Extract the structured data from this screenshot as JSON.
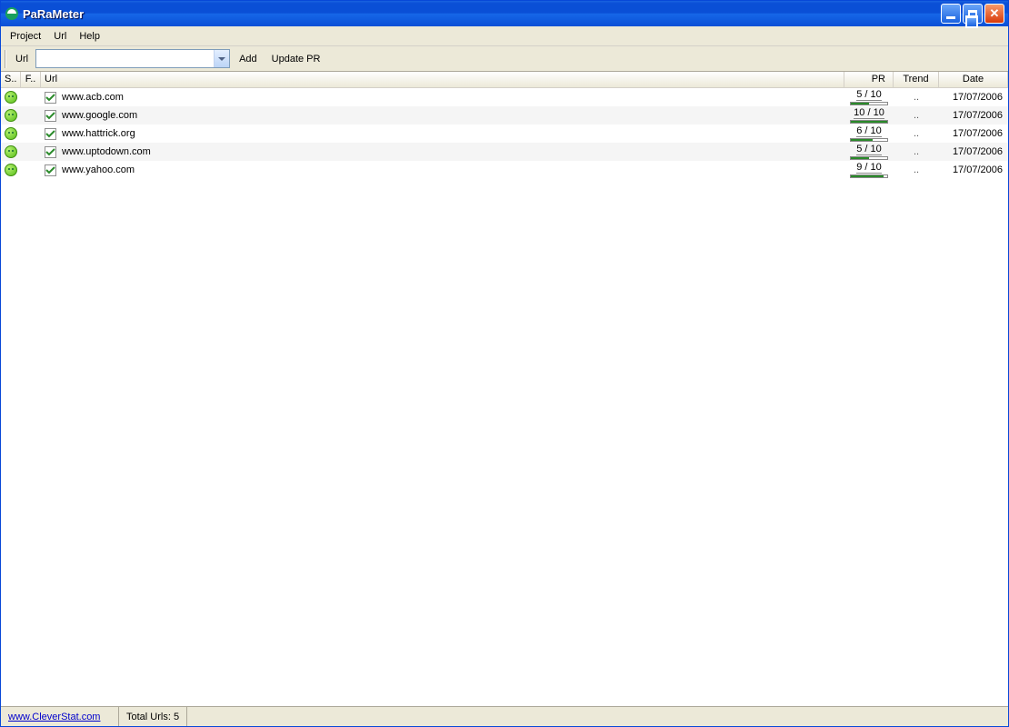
{
  "window": {
    "title": "PaRaMeter"
  },
  "menu": {
    "project": "Project",
    "url": "Url",
    "help": "Help"
  },
  "toolbar": {
    "url_label": "Url",
    "url_value": "",
    "add_label": "Add",
    "update_label": "Update PR"
  },
  "columns": {
    "status": "S..",
    "flag": "F..",
    "url": "Url",
    "pr": "PR",
    "trend": "Trend",
    "date": "Date"
  },
  "rows": [
    {
      "checked": true,
      "url": "www.acb.com",
      "pr": "5 / 10",
      "pr_pct": 50,
      "trend": "..",
      "date": "17/07/2006"
    },
    {
      "checked": true,
      "url": "www.google.com",
      "pr": "10 / 10",
      "pr_pct": 100,
      "trend": "..",
      "date": "17/07/2006"
    },
    {
      "checked": true,
      "url": "www.hattrick.org",
      "pr": "6 / 10",
      "pr_pct": 60,
      "trend": "..",
      "date": "17/07/2006"
    },
    {
      "checked": true,
      "url": "www.uptodown.com",
      "pr": "5 / 10",
      "pr_pct": 50,
      "trend": "..",
      "date": "17/07/2006"
    },
    {
      "checked": true,
      "url": "www.yahoo.com",
      "pr": "9 / 10",
      "pr_pct": 90,
      "trend": "..",
      "date": "17/07/2006"
    }
  ],
  "statusbar": {
    "link": "www.CleverStat.com",
    "total_label": "Total Urls:",
    "total_value": "5"
  }
}
